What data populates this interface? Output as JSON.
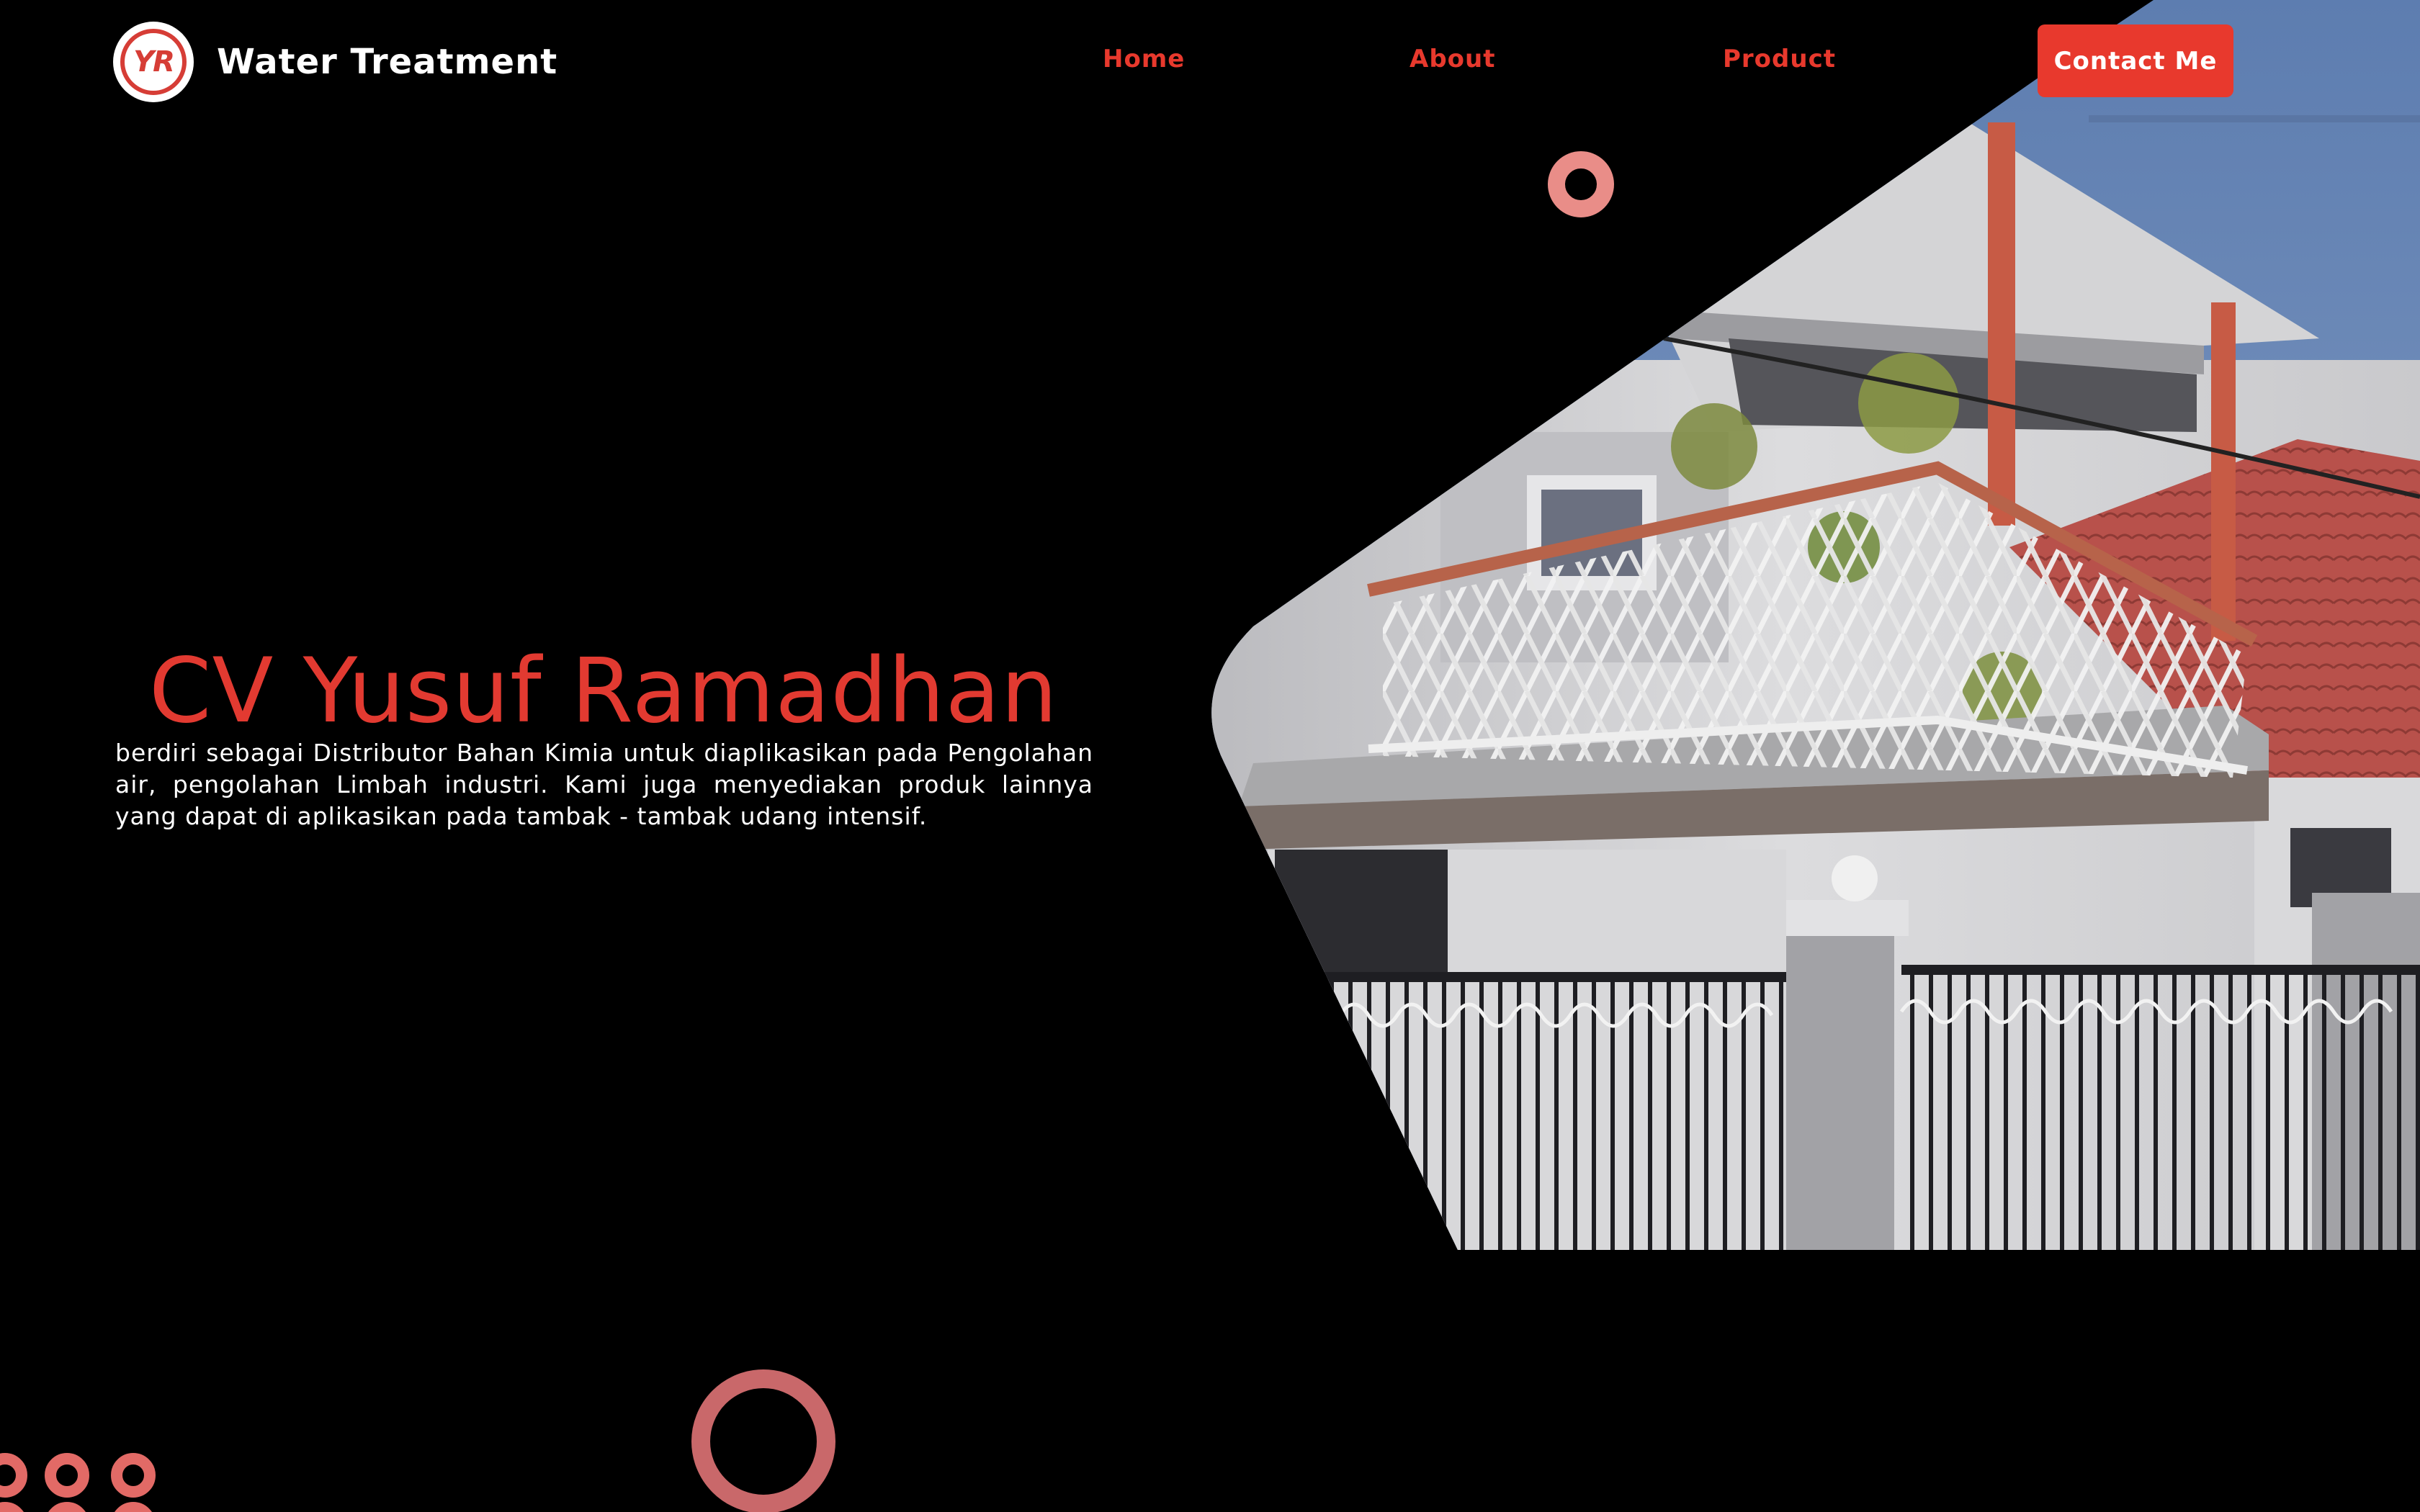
{
  "brand": {
    "name": "Water Treatment",
    "logo_text": "YR"
  },
  "nav": {
    "home": "Home",
    "about": "About",
    "product": "Product",
    "contact": "Contact Me"
  },
  "hero": {
    "title": "CV Yusuf Ramadhan",
    "description": "berdiri sebagai Distributor Bahan Kimia untuk diaplikasikan pada Pengolahan air, pengolahan Limbah industri. Kami juga menyediakan produk lainnya yang dapat di aplikasikan pada tambak - tambak udang intensif."
  },
  "colors": {
    "accent": "#e8392d",
    "background": "#000000",
    "ring": "#e98d88"
  },
  "icons": {
    "logo": "company-logo-icon",
    "hero_image": "house-photo"
  }
}
